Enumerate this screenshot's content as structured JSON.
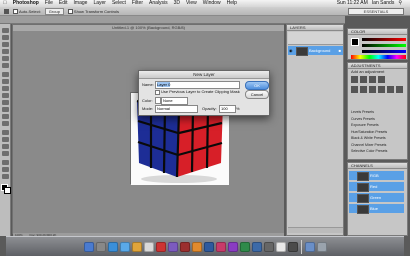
{
  "menubar": {
    "app": "Photoshop",
    "items": [
      "File",
      "Edit",
      "Image",
      "Layer",
      "Select",
      "Filter",
      "Analysis",
      "3D",
      "View",
      "Window",
      "Help"
    ],
    "clock": "Sun 11:22 AM",
    "user": "Ian Sands"
  },
  "options": {
    "auto_select": "Auto-Select:",
    "auto_select_value": "Group",
    "show_transform": "Show Transform Controls"
  },
  "workspace": "ESSENTIALS",
  "document": {
    "tab": "Untitled-1 @ 100% (Background, RGB/8)",
    "zoom": "100%",
    "doc_size": "Doc: 900.2K/900.2K"
  },
  "panels": {
    "layers_title": "LAYERS",
    "color_title": "COLOR",
    "adjustments_title": "ADJUSTMENTS",
    "add_adjustment": "Add an adjustment",
    "channels_title": "CHANNELS",
    "layer_name": "Background",
    "channels": [
      "RGB",
      "Red",
      "Green",
      "Blue"
    ],
    "presets": [
      "Levels Presets",
      "Curves Presets",
      "Exposure Presets",
      "Hue/Saturation Presets",
      "Black & White Presets",
      "Channel Mixer Presets",
      "Selective Color Presets"
    ]
  },
  "dialog": {
    "title": "New Layer",
    "name_label": "Name:",
    "name_value": "Layer 0",
    "clip_label": "Use Previous Layer to Create Clipping Mask",
    "color_label": "Color:",
    "color_value": "None",
    "mode_label": "Mode:",
    "mode_value": "Normal",
    "opacity_label": "Opacity:",
    "opacity_value": "100",
    "opacity_unit": "%",
    "ok": "OK",
    "cancel": "Cancel"
  },
  "colors": {
    "accent": "#5aa0e6",
    "cube_red": "#d8202a",
    "cube_blue": "#1f2f9a",
    "cube_yellow": "#c9c82a"
  }
}
